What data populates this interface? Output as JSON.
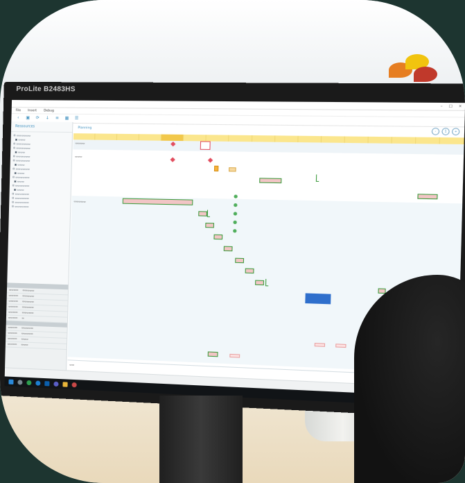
{
  "monitor": {
    "brand": "ProLite B2483HS"
  },
  "app": {
    "menu": [
      "File",
      "Insert",
      "Debug"
    ],
    "sidebar_title": "Ressources",
    "main_title": "Planning",
    "zoom": [
      "-",
      "1",
      "+"
    ],
    "date_columns": [
      "",
      "",
      "",
      "",
      "",
      "",
      "",
      "",
      "",
      "",
      "",
      "",
      "",
      "",
      "",
      "",
      ""
    ],
    "highlight_index": 4
  },
  "colors": {
    "accent": "#3a8dbd",
    "date_header": "#fbe68d",
    "bar_fill": "#f2c5c5",
    "bar_border": "#3b9a3b",
    "milestone": "#e24c5d",
    "selection": "#2f6fcc"
  },
  "taskbar_icons": [
    "windows-icon",
    "search-icon",
    "chrome-icon",
    "edge-icon",
    "outlook-icon",
    "teams-icon",
    "explorer-icon",
    "app-icon"
  ]
}
